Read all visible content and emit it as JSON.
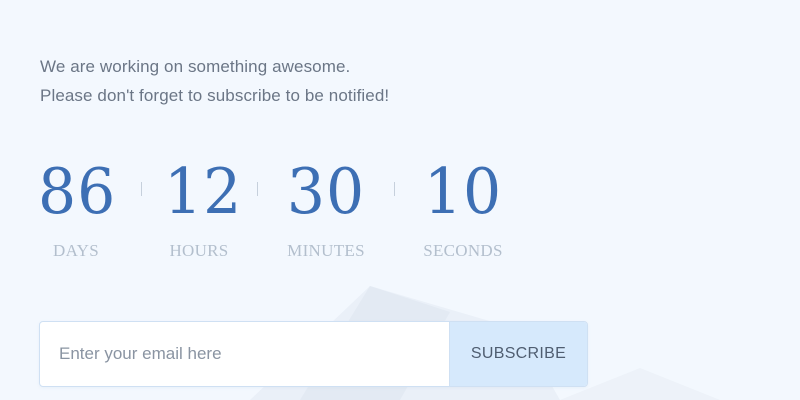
{
  "intro": {
    "line1": "We are working on something awesome.",
    "line2": "Please don't forget to subscribe to be notified!"
  },
  "countdown": {
    "days": {
      "value": "86",
      "label": "DAYS"
    },
    "hours": {
      "value": "12",
      "label": "HOURS"
    },
    "minutes": {
      "value": "30",
      "label": "MINUTES"
    },
    "seconds": {
      "value": "10",
      "label": "SECONDS"
    }
  },
  "subscribe": {
    "placeholder": "Enter your email here",
    "button_label": "SUBSCRIBE"
  },
  "colors": {
    "background": "#f3f8fe",
    "digits": "#3d6fb4",
    "unit_labels": "#b3bfcd",
    "button_bg": "#d6e9fc"
  }
}
